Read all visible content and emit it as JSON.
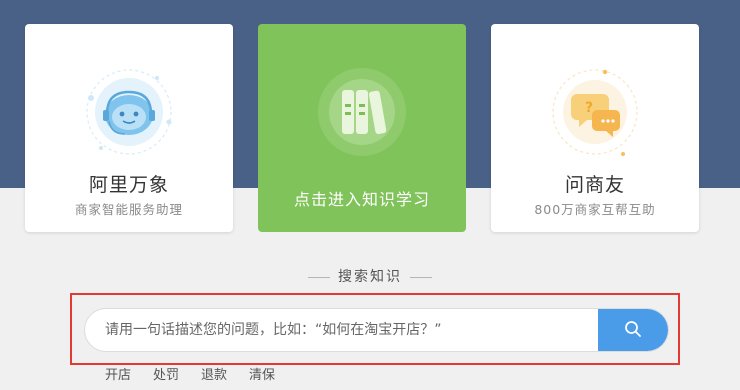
{
  "cards": [
    {
      "title": "阿里万象",
      "subtitle": "商家智能服务助理",
      "icon": "robot-headset-icon"
    },
    {
      "title": "点击进入知识学习",
      "icon": "books-icon"
    },
    {
      "title": "问商友",
      "subtitle": "800万商家互帮互助",
      "icon": "chat-bubbles-icon"
    }
  ],
  "search": {
    "label": "搜索知识",
    "placeholder": "请用一句话描述您的问题，比如：“如何在淘宝开店？”",
    "button_icon": "search-icon"
  },
  "hot_tags": [
    "开店",
    "处罚",
    "退款",
    "清保"
  ],
  "colors": {
    "banner": "#4a6187",
    "card_active": "#80c35b",
    "search_button": "#4a9be8",
    "highlight_frame": "#e43a35"
  }
}
